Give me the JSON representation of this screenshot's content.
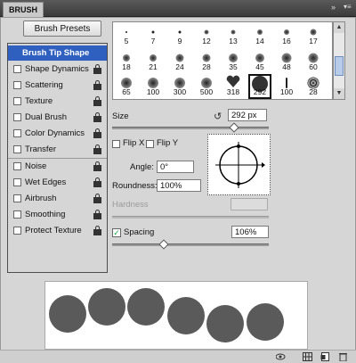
{
  "panel": {
    "tab_title": "BRUSH",
    "collapse_icon": "double-arrow-right",
    "menu_icon": "panel-menu"
  },
  "presets_button": "Brush Presets",
  "sidebar": {
    "items": [
      {
        "label": "Brush Tip Shape",
        "selected": true,
        "checkbox": false,
        "lock": false
      },
      {
        "label": "Shape Dynamics",
        "checked": false,
        "lock": true
      },
      {
        "label": "Scattering",
        "checked": false,
        "lock": true
      },
      {
        "label": "Texture",
        "checked": false,
        "lock": true
      },
      {
        "label": "Dual Brush",
        "checked": false,
        "lock": true
      },
      {
        "label": "Color Dynamics",
        "checked": false,
        "lock": true
      },
      {
        "label": "Transfer",
        "checked": false,
        "lock": true
      },
      {
        "label": "Noise",
        "checked": false,
        "lock": true
      },
      {
        "label": "Wet Edges",
        "checked": false,
        "lock": true
      },
      {
        "label": "Airbrush",
        "checked": false,
        "lock": true
      },
      {
        "label": "Smoothing",
        "checked": false,
        "lock": true
      },
      {
        "label": "Protect Texture",
        "checked": false,
        "lock": true
      }
    ]
  },
  "brush_grid": {
    "rows": [
      [
        "5",
        "7",
        "9",
        "12",
        "13",
        "14",
        "16",
        "17"
      ],
      [
        "18",
        "21",
        "24",
        "28",
        "35",
        "45",
        "48",
        "60"
      ],
      [
        "65",
        "100",
        "300",
        "500",
        "318",
        "292",
        "100",
        "28"
      ]
    ],
    "selected": "292"
  },
  "size": {
    "label": "Size",
    "value": "292 px",
    "slider_fraction": 0.78
  },
  "flip_x": {
    "label": "Flip X",
    "checked": false
  },
  "flip_y": {
    "label": "Flip Y",
    "checked": false
  },
  "angle": {
    "label": "Angle:",
    "value": "0°"
  },
  "roundness": {
    "label": "Roundness:",
    "value": "100%"
  },
  "hardness": {
    "label": "Hardness",
    "value": ""
  },
  "spacing": {
    "label": "Spacing",
    "checked": true,
    "value": "106%",
    "slider_fraction": 0.33
  },
  "footer_icons": [
    "eye-brush-icon",
    "grid-icon",
    "new-preset-icon",
    "trash-icon"
  ],
  "colors": {
    "selected_item": "#2f5fbf",
    "panel_bg": "#d6d6d6",
    "dot_fill": "#5a5a5a"
  }
}
